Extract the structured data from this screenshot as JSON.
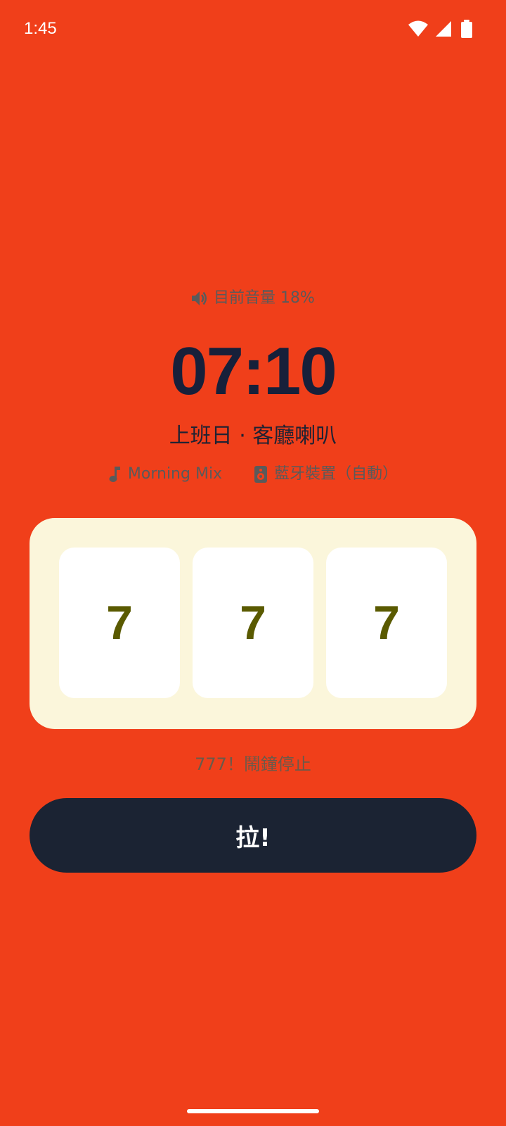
{
  "status_bar": {
    "time": "1:45",
    "icons": [
      "wifi-icon",
      "cell-signal-icon",
      "battery-icon"
    ]
  },
  "volume": {
    "icon": "speaker-icon",
    "text": "目前音量 18%"
  },
  "alarm": {
    "time": "07:10",
    "label": "上班日 · 客廳喇叭",
    "music": {
      "icon": "music-note-icon",
      "text": "Morning Mix"
    },
    "device": {
      "icon": "speaker-device-icon",
      "text": "藍牙裝置（自動）"
    }
  },
  "slot": {
    "reels": [
      "7",
      "7",
      "7"
    ],
    "result": "777！鬧鐘停止"
  },
  "pull_button": {
    "label": "拉!"
  },
  "colors": {
    "background": "#F03F1A",
    "panel": "#FBF6DB",
    "reel_digit": "#5A5A00",
    "button": "#1B2333",
    "time_text": "#17203A"
  }
}
